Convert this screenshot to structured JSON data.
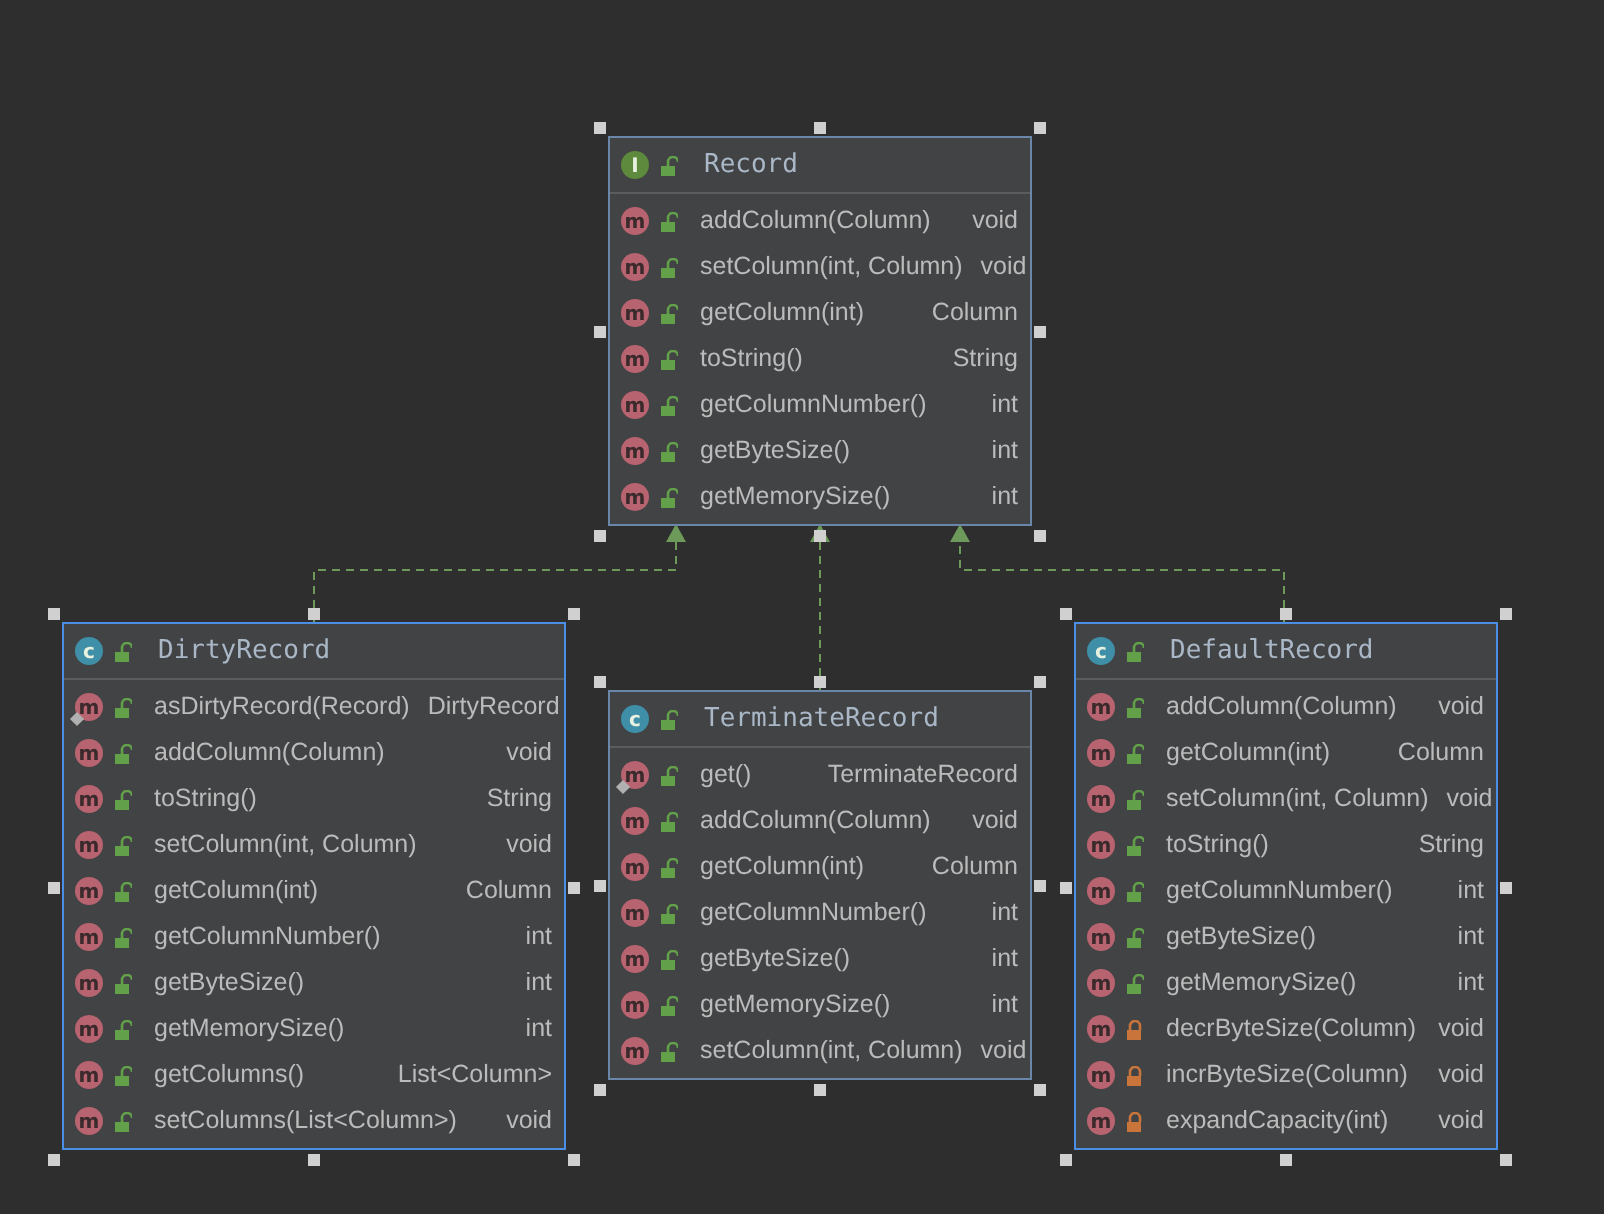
{
  "classes": [
    {
      "kind": "interface",
      "badge": "I",
      "name": "Record",
      "selected": false,
      "methods": [
        {
          "badge": "m",
          "private": false,
          "static": false,
          "signature": "addColumn(Column)",
          "returns": "void"
        },
        {
          "badge": "m",
          "private": false,
          "static": false,
          "signature": "setColumn(int, Column)",
          "returns": "void"
        },
        {
          "badge": "m",
          "private": false,
          "static": false,
          "signature": "getColumn(int)",
          "returns": "Column"
        },
        {
          "badge": "m",
          "private": false,
          "static": false,
          "signature": "toString()",
          "returns": "String"
        },
        {
          "badge": "m",
          "private": false,
          "static": false,
          "signature": "getColumnNumber()",
          "returns": "int"
        },
        {
          "badge": "m",
          "private": false,
          "static": false,
          "signature": "getByteSize()",
          "returns": "int"
        },
        {
          "badge": "m",
          "private": false,
          "static": false,
          "signature": "getMemorySize()",
          "returns": "int"
        }
      ]
    },
    {
      "kind": "class",
      "badge": "c",
      "name": "DirtyRecord",
      "selected": true,
      "methods": [
        {
          "badge": "m",
          "private": false,
          "static": true,
          "signature": "asDirtyRecord(Record)",
          "returns": "DirtyRecord"
        },
        {
          "badge": "m",
          "private": false,
          "static": false,
          "signature": "addColumn(Column)",
          "returns": "void"
        },
        {
          "badge": "m",
          "private": false,
          "static": false,
          "signature": "toString()",
          "returns": "String"
        },
        {
          "badge": "m",
          "private": false,
          "static": false,
          "signature": "setColumn(int, Column)",
          "returns": "void"
        },
        {
          "badge": "m",
          "private": false,
          "static": false,
          "signature": "getColumn(int)",
          "returns": "Column"
        },
        {
          "badge": "m",
          "private": false,
          "static": false,
          "signature": "getColumnNumber()",
          "returns": "int"
        },
        {
          "badge": "m",
          "private": false,
          "static": false,
          "signature": "getByteSize()",
          "returns": "int"
        },
        {
          "badge": "m",
          "private": false,
          "static": false,
          "signature": "getMemorySize()",
          "returns": "int"
        },
        {
          "badge": "m",
          "private": false,
          "static": false,
          "signature": "getColumns()",
          "returns": "List<Column>"
        },
        {
          "badge": "m",
          "private": false,
          "static": false,
          "signature": "setColumns(List<Column>)",
          "returns": "void"
        }
      ]
    },
    {
      "kind": "class",
      "badge": "c",
      "name": "TerminateRecord",
      "selected": false,
      "methods": [
        {
          "badge": "m",
          "private": false,
          "static": true,
          "signature": "get()",
          "returns": "TerminateRecord"
        },
        {
          "badge": "m",
          "private": false,
          "static": false,
          "signature": "addColumn(Column)",
          "returns": "void"
        },
        {
          "badge": "m",
          "private": false,
          "static": false,
          "signature": "getColumn(int)",
          "returns": "Column"
        },
        {
          "badge": "m",
          "private": false,
          "static": false,
          "signature": "getColumnNumber()",
          "returns": "int"
        },
        {
          "badge": "m",
          "private": false,
          "static": false,
          "signature": "getByteSize()",
          "returns": "int"
        },
        {
          "badge": "m",
          "private": false,
          "static": false,
          "signature": "getMemorySize()",
          "returns": "int"
        },
        {
          "badge": "m",
          "private": false,
          "static": false,
          "signature": "setColumn(int, Column)",
          "returns": "void"
        }
      ]
    },
    {
      "kind": "class",
      "badge": "c",
      "name": "DefaultRecord",
      "selected": true,
      "methods": [
        {
          "badge": "m",
          "private": false,
          "static": false,
          "signature": "addColumn(Column)",
          "returns": "void"
        },
        {
          "badge": "m",
          "private": false,
          "static": false,
          "signature": "getColumn(int)",
          "returns": "Column"
        },
        {
          "badge": "m",
          "private": false,
          "static": false,
          "signature": "setColumn(int, Column)",
          "returns": "void"
        },
        {
          "badge": "m",
          "private": false,
          "static": false,
          "signature": "toString()",
          "returns": "String"
        },
        {
          "badge": "m",
          "private": false,
          "static": false,
          "signature": "getColumnNumber()",
          "returns": "int"
        },
        {
          "badge": "m",
          "private": false,
          "static": false,
          "signature": "getByteSize()",
          "returns": "int"
        },
        {
          "badge": "m",
          "private": false,
          "static": false,
          "signature": "getMemorySize()",
          "returns": "int"
        },
        {
          "badge": "m",
          "private": true,
          "static": false,
          "signature": "decrByteSize(Column)",
          "returns": "void"
        },
        {
          "badge": "m",
          "private": true,
          "static": false,
          "signature": "incrByteSize(Column)",
          "returns": "void"
        },
        {
          "badge": "m",
          "private": true,
          "static": false,
          "signature": "expandCapacity(int)",
          "returns": "void"
        }
      ]
    }
  ]
}
